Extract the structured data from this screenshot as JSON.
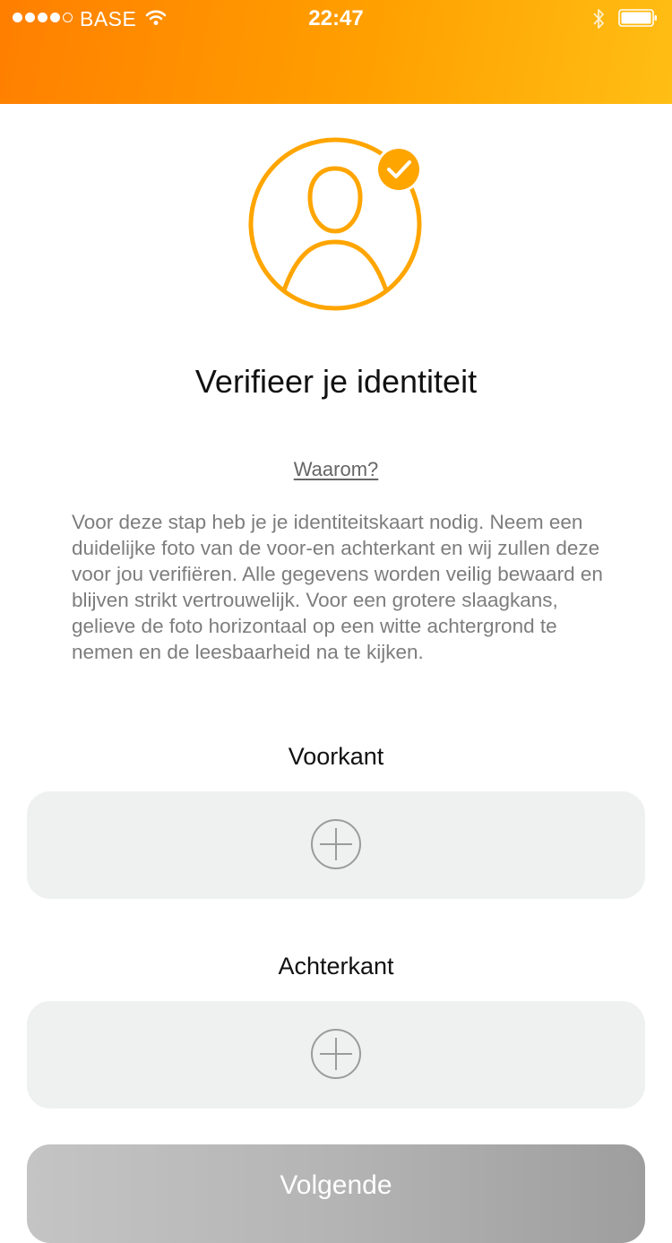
{
  "status_bar": {
    "carrier": "BASE",
    "time": "22:47",
    "signal_bars_filled": 4,
    "signal_bars_total": 5,
    "icons": [
      "signal-dots-icon",
      "wifi-icon",
      "bluetooth-icon",
      "battery-icon"
    ]
  },
  "colors": {
    "header_gradient_start": "#ff7f00",
    "header_gradient_end": "#ffbe14",
    "accent": "#ffa000",
    "upload_box_bg": "#eff1f0",
    "button_disabled": "#b4b4b4"
  },
  "main": {
    "avatar_icon": "user-verified-icon",
    "title": "Verifieer je identiteit",
    "why_link": "Waarom?",
    "description": "Voor deze stap heb je je identiteitskaart nodig. Neem een duidelijke foto van de voor-en achterkant en wij zullen deze voor jou verifiëren. Alle gegevens worden veilig bewaard en blijven strikt vertrouwelijk. Voor een grotere slaagkans, gelieve de foto horizontaal op een witte achtergrond te nemen en de leesbaarheid na te kijken.",
    "front": {
      "label": "Voorkant",
      "icon": "plus-circle-icon"
    },
    "back": {
      "label": "Achterkant",
      "icon": "plus-circle-icon"
    },
    "next_button": "Volgende"
  }
}
